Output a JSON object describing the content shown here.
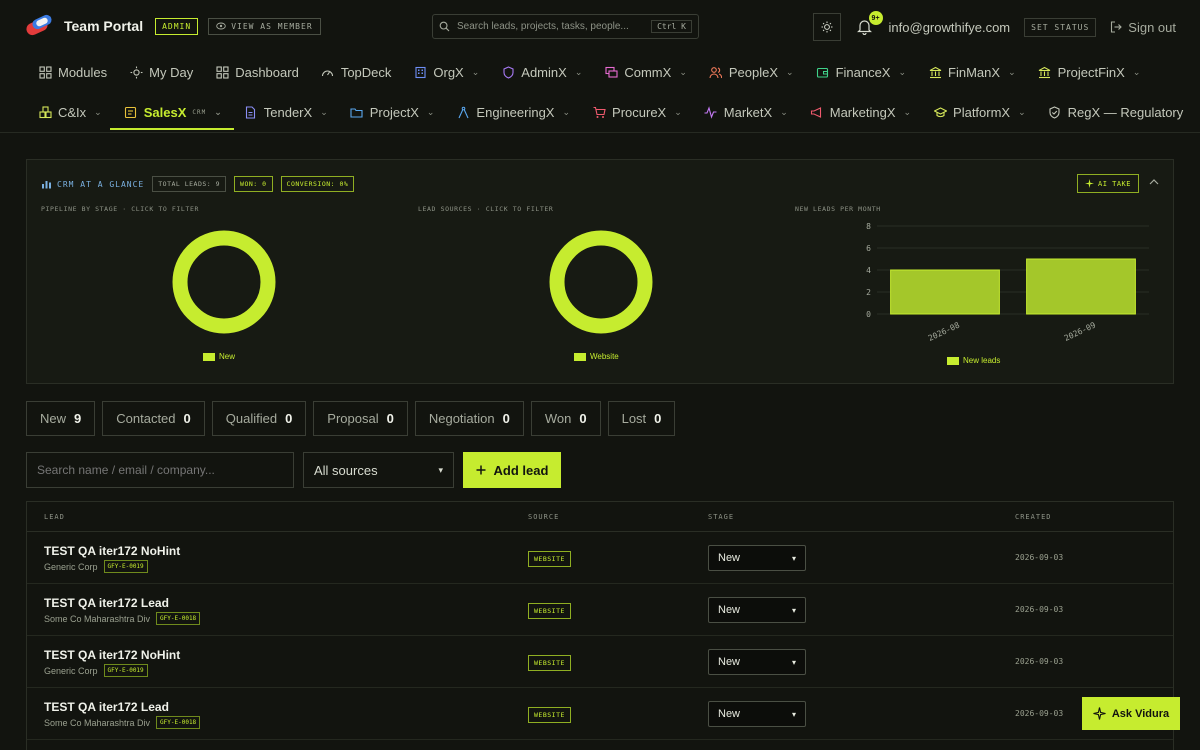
{
  "header": {
    "brand": "Team Portal",
    "admin_tag": "ADMIN",
    "view_as": "VIEW AS MEMBER",
    "search_placeholder": "Search leads, projects, tasks, people...",
    "search_shortcut": "Ctrl K",
    "notif_count": "9+",
    "email": "info@growthifye.com",
    "set_status": "SET STATUS",
    "sign_out": "Sign out"
  },
  "nav_row1": [
    {
      "label": "Modules",
      "icon": "grid-icon",
      "chev": false
    },
    {
      "label": "My Day",
      "icon": "sun-icon",
      "chev": false
    },
    {
      "label": "Dashboard",
      "icon": "dashboard-icon",
      "chev": false
    },
    {
      "label": "TopDeck",
      "icon": "gauge-icon",
      "chev": false
    },
    {
      "label": "OrgX",
      "icon": "building-icon",
      "chev": true
    },
    {
      "label": "AdminX",
      "icon": "shield-icon",
      "chev": true
    },
    {
      "label": "CommX",
      "icon": "chat-icon",
      "chev": true
    },
    {
      "label": "PeopleX",
      "icon": "people-icon",
      "chev": true
    },
    {
      "label": "FinanceX",
      "icon": "wallet-icon",
      "chev": true
    },
    {
      "label": "FinManX",
      "icon": "bank-icon",
      "chev": true
    },
    {
      "label": "ProjectFinX",
      "icon": "bank-icon",
      "chev": true
    }
  ],
  "nav_row2": [
    {
      "label": "C&Ix",
      "icon": "boxes-icon",
      "chev": true
    },
    {
      "label": "SalesX",
      "icon": "sales-icon",
      "chev": true,
      "active": true,
      "sub": "CRM"
    },
    {
      "label": "TenderX",
      "icon": "document-icon",
      "chev": true
    },
    {
      "label": "ProjectX",
      "icon": "folder-icon",
      "chev": true
    },
    {
      "label": "EngineeringX",
      "icon": "compass-icon",
      "chev": true
    },
    {
      "label": "ProcureX",
      "icon": "cart-icon",
      "chev": true
    },
    {
      "label": "MarketX",
      "icon": "pulse-icon",
      "chev": true
    },
    {
      "label": "MarketingX",
      "icon": "megaphone-icon",
      "chev": true
    },
    {
      "label": "PlatformX",
      "icon": "graduation-icon",
      "chev": true
    },
    {
      "label": "RegX — Regulatory",
      "icon": "shield-check-icon",
      "chev": false
    }
  ],
  "crm_panel": {
    "title": "CRM AT A GLANCE",
    "total_leads": "TOTAL LEADS: 9",
    "won": "WON: 0",
    "conversion": "CONVERSION: 0%",
    "ai_take": "AI TAKE",
    "pipeline_label": "PIPELINE BY STAGE · CLICK TO FILTER",
    "sources_label": "LEAD SOURCES · CLICK TO FILTER",
    "monthly_label": "NEW LEADS PER MONTH",
    "accent": "#c6ec2f"
  },
  "chart_data": [
    {
      "type": "pie",
      "categories": [
        "New"
      ],
      "values": [
        9
      ],
      "legend": "bottom",
      "style": "donut"
    },
    {
      "type": "pie",
      "categories": [
        "Website"
      ],
      "values": [
        9
      ],
      "legend": "bottom",
      "style": "donut"
    },
    {
      "type": "bar",
      "categories": [
        "2026-08",
        "2026-09"
      ],
      "series": [
        {
          "name": "New leads",
          "values": [
            4,
            5
          ]
        }
      ],
      "ylim": [
        0,
        8
      ],
      "yticks": [
        "0",
        "2",
        "4",
        "6",
        "8"
      ],
      "legend": "bottom",
      "grid": true
    }
  ],
  "stages": [
    {
      "label": "New",
      "count": "9"
    },
    {
      "label": "Contacted",
      "count": "0"
    },
    {
      "label": "Qualified",
      "count": "0"
    },
    {
      "label": "Proposal",
      "count": "0"
    },
    {
      "label": "Negotiation",
      "count": "0"
    },
    {
      "label": "Won",
      "count": "0"
    },
    {
      "label": "Lost",
      "count": "0"
    }
  ],
  "filters": {
    "search_placeholder": "Search name / email / company...",
    "source_value": "All sources",
    "add_lead": "Add lead"
  },
  "table": {
    "columns": [
      "LEAD",
      "SOURCE",
      "STAGE",
      "CREATED"
    ],
    "rows": [
      {
        "name": "TEST QA iter172 NoHint",
        "company": "Generic Corp",
        "code": "GFY-E-0019",
        "source": "WEBSITE",
        "stage": "New",
        "created": "2026-09-03"
      },
      {
        "name": "TEST QA iter172 Lead",
        "company": "Some Co Maharashtra Div",
        "code": "GFY-E-0018",
        "source": "WEBSITE",
        "stage": "New",
        "created": "2026-09-03"
      },
      {
        "name": "TEST QA iter172 NoHint",
        "company": "Generic Corp",
        "code": "GFY-E-0019",
        "source": "WEBSITE",
        "stage": "New",
        "created": "2026-09-03"
      },
      {
        "name": "TEST QA iter172 Lead",
        "company": "Some Co Maharashtra Div",
        "code": "GFY-E-0018",
        "source": "WEBSITE",
        "stage": "New",
        "created": "2026-09-03"
      }
    ]
  },
  "ask_vidura": "Ask Vidura"
}
